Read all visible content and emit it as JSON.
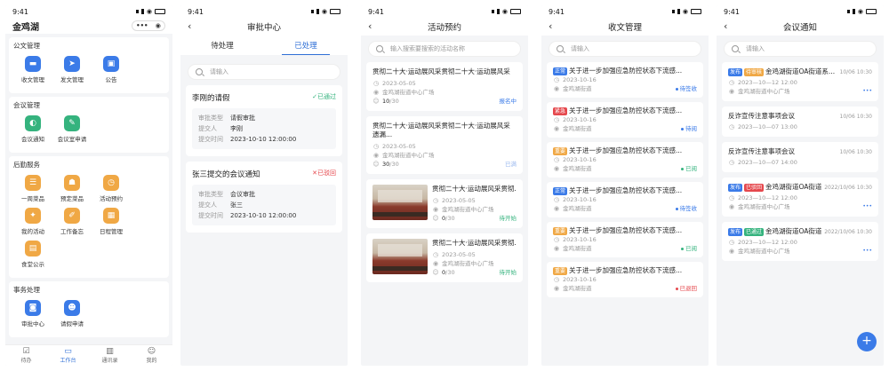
{
  "status": {
    "time": "9:41"
  },
  "home": {
    "title": "金鸡湖",
    "sections": [
      {
        "title": "公文管理",
        "items": [
          {
            "label": "收文管理",
            "color": "#3b7be8",
            "icon": "folder-icon"
          },
          {
            "label": "发文管理",
            "color": "#3b7be8",
            "icon": "send-icon"
          },
          {
            "label": "公告",
            "color": "#3b7be8",
            "icon": "briefcase-icon"
          }
        ]
      },
      {
        "title": "会议管理",
        "items": [
          {
            "label": "会议通知",
            "color": "#35b37e",
            "icon": "speaker-icon"
          },
          {
            "label": "会议室申请",
            "color": "#35b37e",
            "icon": "edit-icon"
          }
        ]
      },
      {
        "title": "后勤服务",
        "items": [
          {
            "label": "一周菜品",
            "color": "#f0a845",
            "icon": "food-icon"
          },
          {
            "label": "预定菜品",
            "color": "#f0a845",
            "icon": "dish-icon"
          },
          {
            "label": "活动预约",
            "color": "#f0a845",
            "icon": "clock-icon"
          },
          {
            "label": "我的活动",
            "color": "#f0a845",
            "icon": "star-icon"
          },
          {
            "label": "工作备忘",
            "color": "#f0a845",
            "icon": "note-icon"
          },
          {
            "label": "日程管理",
            "color": "#f0a845",
            "icon": "calendar-icon"
          },
          {
            "label": "食堂公示",
            "color": "#f0a845",
            "icon": "bag-icon"
          }
        ]
      },
      {
        "title": "事务处理",
        "items": [
          {
            "label": "审批中心",
            "color": "#3b7be8",
            "icon": "user-card-icon"
          },
          {
            "label": "请假申请",
            "color": "#3b7be8",
            "icon": "person-icon"
          }
        ]
      }
    ],
    "tabbar": [
      {
        "label": "待办",
        "icon": "todo-icon"
      },
      {
        "label": "工作台",
        "icon": "desk-icon"
      },
      {
        "label": "通讯录",
        "icon": "contacts-icon"
      },
      {
        "label": "我的",
        "icon": "profile-icon"
      }
    ]
  },
  "approval": {
    "title": "审批中心",
    "tabs": [
      "待处理",
      "已处理"
    ],
    "search_placeholder": "请输入",
    "cards": [
      {
        "title": "李刚的请假",
        "status": "已通过",
        "status_color": "#35b37e",
        "status_icon": "✓",
        "rows": [
          {
            "k": "审批类型",
            "v": "请假审批"
          },
          {
            "k": "提交人",
            "v": "李刚"
          },
          {
            "k": "提交时间",
            "v": "2023-10-10 12:00:00"
          }
        ]
      },
      {
        "title": "张三提交的会议通知",
        "status": "已驳回",
        "status_color": "#e5484d",
        "status_icon": "✕",
        "rows": [
          {
            "k": "审批类型",
            "v": "会议审批"
          },
          {
            "k": "提交人",
            "v": "张三"
          },
          {
            "k": "提交时间",
            "v": "2023-10-10 12:00:00"
          }
        ]
      }
    ]
  },
  "events": {
    "title": "活动预约",
    "search_placeholder": "输入搜索要搜索的活动名称",
    "cards": [
      {
        "title": "贯彻二十大·运动展风采贯彻二十大·运动展风采",
        "date": "2023-05-05",
        "place": "金鸡湖街道中心广场",
        "count": "10",
        "total": "/30",
        "status": "报名中",
        "status_color": "#3b7be8",
        "thumb": false
      },
      {
        "title": "贯彻二十大·运动展风采贯彻二十大·运动展风采遗漏...",
        "date": "2023-05-05",
        "place": "金鸡湖街道中心广场",
        "count": "30",
        "total": "/30",
        "status": "已满",
        "status_color": "#9ab8ef",
        "thumb": false
      },
      {
        "title": "贯彻二十大·运动展风采贯彻...",
        "date": "2023-05-05",
        "place": "金鸡湖街道中心广场",
        "count": "0",
        "total": "/30",
        "status": "待开始",
        "status_color": "#35b37e",
        "thumb": true
      },
      {
        "title": "贯彻二十大·运动展风采贯彻...",
        "date": "2023-05-05",
        "place": "金鸡湖街道中心广场",
        "count": "0",
        "total": "/30",
        "status": "待开始",
        "status_color": "#35b37e",
        "thumb": true
      }
    ]
  },
  "docs": {
    "title": "收文管理",
    "search_placeholder": "请输入",
    "cards": [
      {
        "tag": "正常",
        "tag_color": "#3b7be8",
        "title": "关于进一步加强应急防控状态下流感...",
        "date": "2023-10-16",
        "place": "金鸡湖街道",
        "status": "待签收",
        "status_color": "#3b7be8"
      },
      {
        "tag": "紧急",
        "tag_color": "#e5484d",
        "title": "关于进一步加强应急防控状态下流感...",
        "date": "2023-10-16",
        "place": "金鸡湖街道",
        "status": "待阅",
        "status_color": "#3b7be8"
      },
      {
        "tag": "重要",
        "tag_color": "#f0a845",
        "title": "关于进一步加强应急防控状态下流感...",
        "date": "2023-10-16",
        "place": "金鸡湖街道",
        "status": "已阅",
        "status_color": "#35b37e"
      },
      {
        "tag": "正常",
        "tag_color": "#3b7be8",
        "title": "关于进一步加强应急防控状态下流感...",
        "date": "2023-10-16",
        "place": "金鸡湖街道",
        "status": "待签收",
        "status_color": "#3b7be8"
      },
      {
        "tag": "重要",
        "tag_color": "#f0a845",
        "title": "关于进一步加强应急防控状态下流感...",
        "date": "2023-10-16",
        "place": "金鸡湖街道",
        "status": "已阅",
        "status_color": "#35b37e"
      },
      {
        "tag": "重要",
        "tag_color": "#f0a845",
        "title": "关于进一步加强应急防控状态下流感...",
        "date": "2023-10-16",
        "place": "金鸡湖街道",
        "status": "已退回",
        "status_color": "#e5484d"
      }
    ]
  },
  "meetings": {
    "title": "会议通知",
    "search_placeholder": "请输入",
    "cards": [
      {
        "tags": [
          {
            "t": "发布",
            "c": "#3b7be8"
          },
          {
            "t": "待审核",
            "c": "#f0a845"
          }
        ],
        "title": "金鸡湖街道OA街道系...",
        "time": "10/06 10:30",
        "date": "2023—10—12 12:00",
        "place": "金鸡湖街道中心广场",
        "more": true
      },
      {
        "tags": [],
        "title": "反诈宣传注意事项会议",
        "time": "10/06 10:30",
        "date": "2023—10—07 13:00",
        "place": "",
        "more": false
      },
      {
        "tags": [],
        "title": "反诈宣传注意事项会议",
        "time": "10/06 10:30",
        "date": "2023—10—07 14:00",
        "place": "",
        "more": false
      },
      {
        "tags": [
          {
            "t": "发布",
            "c": "#3b7be8"
          },
          {
            "t": "已驳回",
            "c": "#e5484d"
          }
        ],
        "title": "金鸡湖街道OA街道系...",
        "time": "2022/10/06 10:30",
        "date": "2023—10—12 12:00",
        "place": "金鸡湖街道中心广场",
        "more": true
      },
      {
        "tags": [
          {
            "t": "发布",
            "c": "#3b7be8"
          },
          {
            "t": "已通过",
            "c": "#35b37e"
          }
        ],
        "title": "金鸡湖街道OA街道系...",
        "time": "2022/10/06 10:30",
        "date": "2023—10—12 12:00",
        "place": "金鸡湖街道中心广场",
        "more": true
      }
    ],
    "fab": "+"
  }
}
